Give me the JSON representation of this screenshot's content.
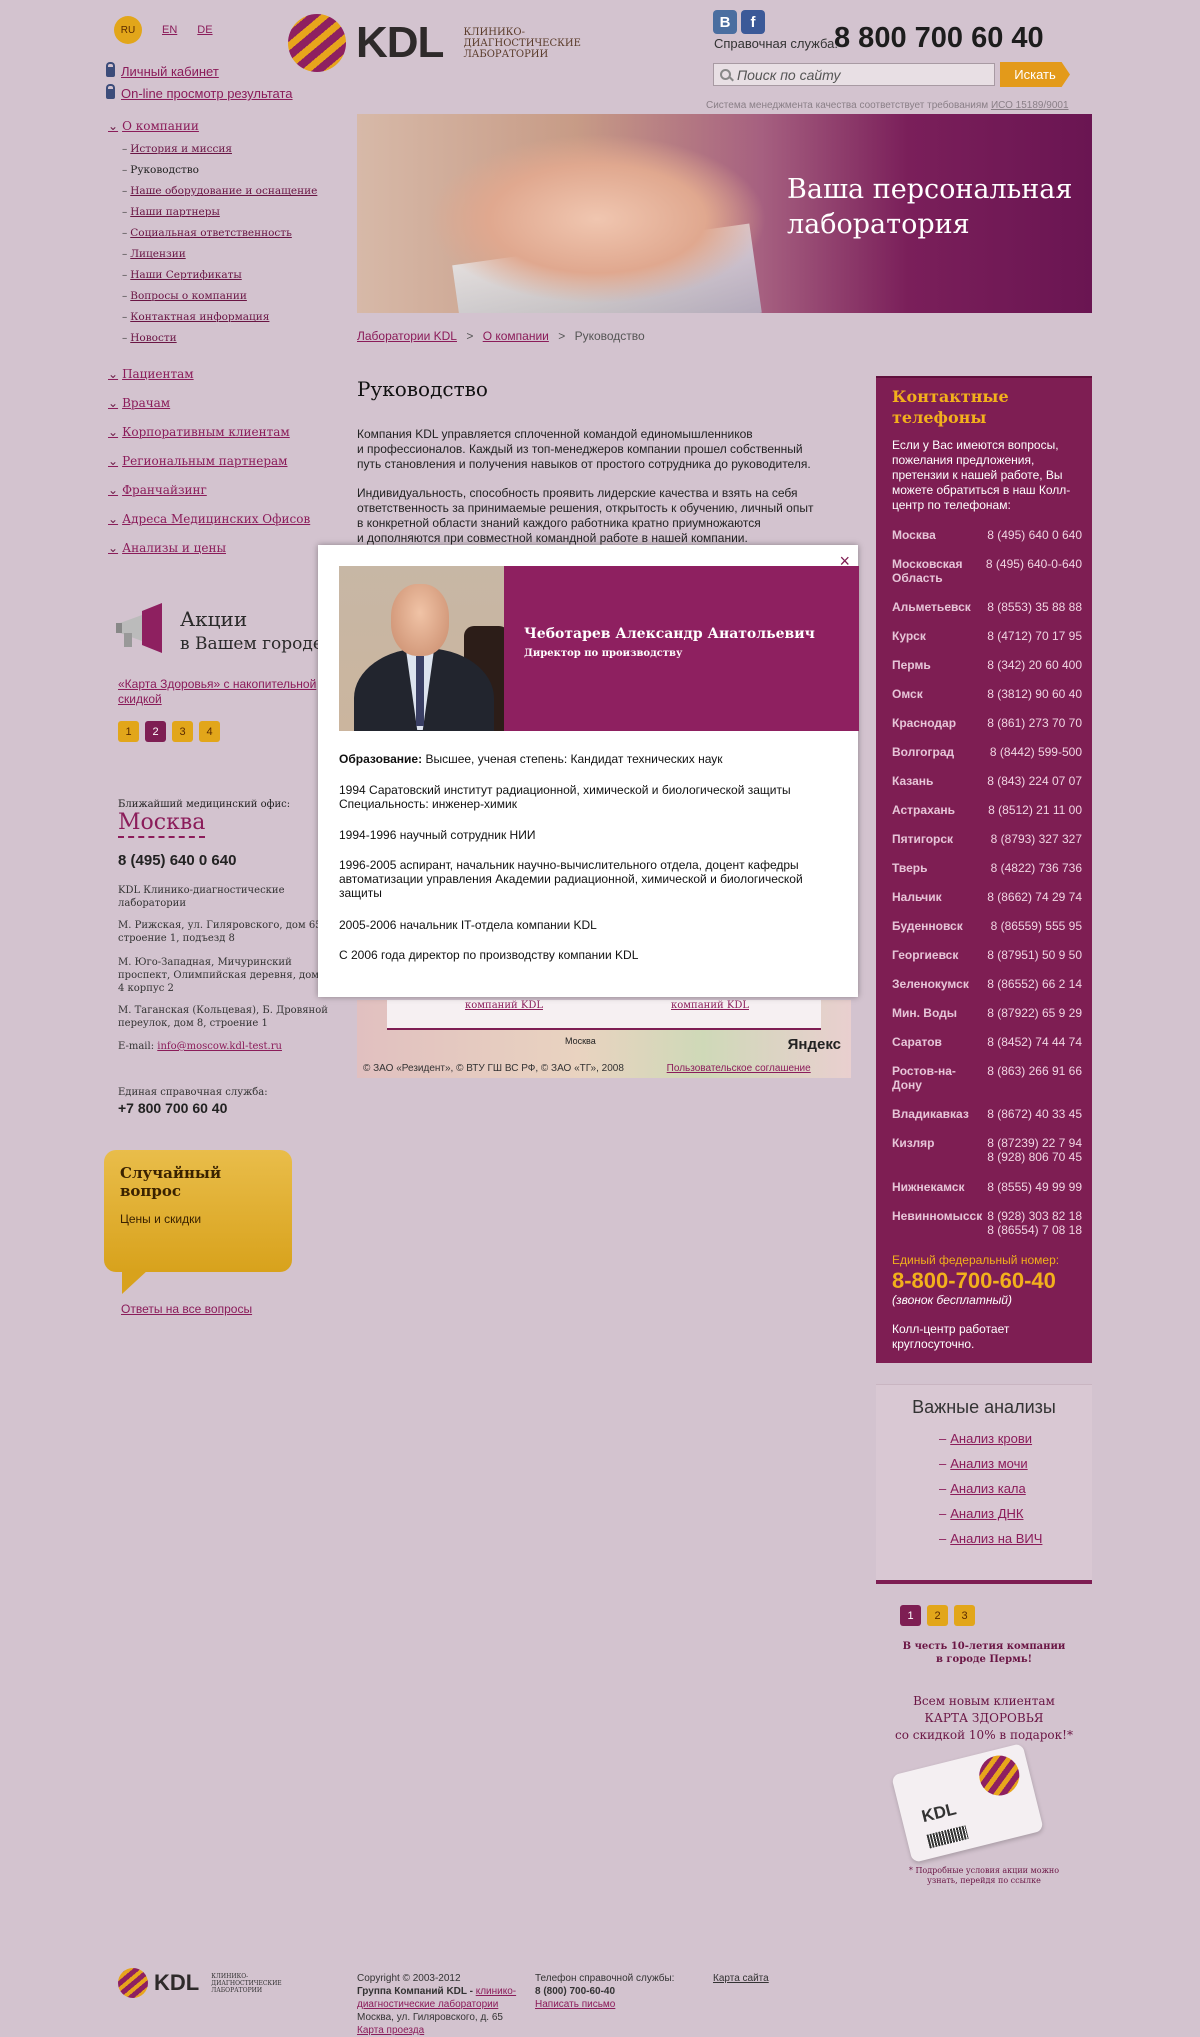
{
  "header": {
    "lang": {
      "current": "RU",
      "others": [
        "EN",
        "DE"
      ]
    },
    "account_links": [
      "Личный кабинет",
      "On-line просмотр результата"
    ],
    "logo": {
      "name": "KDL",
      "subtitle_lines": [
        "КЛИНИКО-",
        "ДИАГНОСТИЧЕСКИЕ",
        "ЛАБОРАТОРИИ"
      ]
    },
    "social": {
      "vk": "В",
      "fb": "f"
    },
    "service_label": "Справочная служба:",
    "service_phone": "8 800 700 60 40",
    "search_placeholder": "Поиск по сайту",
    "search_button": "Искать",
    "iso_text": "Система менеджмента качества соответствует требованиям",
    "iso_link": "ИСО 15189/9001"
  },
  "nav": {
    "about": "О компании",
    "about_sub": [
      "История и миссия",
      "Руководство",
      "Наше оборудование и оснащение",
      "Наши партнеры",
      "Социальная ответственность",
      "Лицензии",
      "Наши Сертификаты",
      "Вопросы о компании",
      "Контактная информация",
      "Новости"
    ],
    "sections": [
      "Пациентам",
      "Врачам",
      "Корпоративным клиентам",
      "Региональным партнерам",
      "Франчайзинг",
      "Адреса Медицинских Офисов",
      "Анализы и цены"
    ]
  },
  "promo": {
    "title": "Акции",
    "subtitle": "в Вашем городе",
    "link": "«Карта Здоровья» с накопительной скидкой",
    "pages": [
      "1",
      "2",
      "3",
      "4"
    ]
  },
  "nearest": {
    "label": "Ближайший медицинский офис:",
    "city": "Москва",
    "phone": "8 (495) 640 0 640",
    "org": "KDL Клинико-диагностические лаборатории",
    "addr1": "М. Рижская, ул. Гиляровского, дом 65, строение 1, подъезд 8",
    "addr2": "М. Юго-Западная, Мичуринский проспект, Олимпийская деревня, дом 4 корпус 2",
    "addr3": "М. Таганская (Кольцевая), Б. Дровяной переулок, дом 8, строение 1",
    "email_label": "E-mail:",
    "email": "info@moscow.kdl-test.ru",
    "unified_label": "Единая справочная служба:",
    "unified_phone": "+7 800 700 60 40"
  },
  "random_q": {
    "title": "Случайный вопрос",
    "text": "Цены и скидки",
    "all": "Ответы на все вопросы"
  },
  "hero": {
    "line1": "Ваша персональная",
    "line2": "лаборатория"
  },
  "breadcrumb": {
    "items": [
      "Лаборатории KDL",
      "О компании"
    ],
    "current": "Руководство",
    "sep": ">"
  },
  "page": {
    "title": "Руководство",
    "p1_l1": "Компания KDL управляется сплоченной командой единомышленников",
    "p1_l2": "и профессионалов. Каждый из топ-менеджеров компании прошел собственный",
    "p1_l3": "путь становления и получения навыков от простого сотрудника до руководителя.",
    "p2_l1": "Индивидуальность, способность проявить лидерские качества и взять на себя",
    "p2_l2": "ответственность за принимаемые решения, открытость к обучению, личный опыт",
    "p2_l3": "в конкретной области знаний каждого работника кратно приумножаются",
    "p2_l4": "и дополняются при совместной командной работе в нашей компании."
  },
  "map": {
    "card_links": [
      "компаний KDL",
      "компаний KDL"
    ],
    "city": "Москва",
    "footer": "© ЗАО «Резидент», © ВТУ ГШ ВС РФ, © ЗАО «ТГ», 2008",
    "agreement": "Пользовательское соглашение",
    "yandex": "Яндекс"
  },
  "contacts": {
    "title_l1": "Контактные",
    "title_l2": "телефоны",
    "intro": "Если у Вас имеются вопросы, пожелания предложения, претензии к нашей работе, Вы можете обратиться в наш Колл-центр по телефонам:",
    "rows": [
      {
        "city": "Москва",
        "phone": "8 (495) 640 0 640"
      },
      {
        "city": "Московская Область",
        "phone": "8 (495) 640-0-640"
      },
      {
        "city": "Альметьевск",
        "phone": "8 (8553) 35 88 88"
      },
      {
        "city": "Курск",
        "phone": "8 (4712) 70 17 95"
      },
      {
        "city": "Пермь",
        "phone": "8 (342) 20 60 400"
      },
      {
        "city": "Омск",
        "phone": "8 (3812) 90 60 40"
      },
      {
        "city": "Краснодар",
        "phone": "8 (861) 273 70 70"
      },
      {
        "city": "Волгоград",
        "phone": "8 (8442) 599-500"
      },
      {
        "city": "Казань",
        "phone": "8 (843) 224 07 07"
      },
      {
        "city": "Астрахань",
        "phone": "8 (8512) 21 11 00"
      },
      {
        "city": "Пятигорск",
        "phone": "8 (8793) 327 327"
      },
      {
        "city": "Тверь",
        "phone": "8 (4822) 736 736"
      },
      {
        "city": "Нальчик",
        "phone": "8 (8662) 74 29 74"
      },
      {
        "city": "Буденновск",
        "phone": "8 (86559) 555 95"
      },
      {
        "city": "Георгиевск",
        "phone": "8 (87951) 50 9 50"
      },
      {
        "city": "Зеленокумск",
        "phone": "8 (86552) 66 2 14"
      },
      {
        "city": "Мин. Воды",
        "phone": "8 (87922) 65 9 29"
      },
      {
        "city": "Саратов",
        "phone": "8 (8452) 74 44 74"
      },
      {
        "city": "Ростов-на-Дону",
        "phone": "8 (863) 266 91 66"
      },
      {
        "city": "Владикавказ",
        "phone": "8 (8672) 40 33 45"
      },
      {
        "city": "Кизляр",
        "phone": "8 (87239) 22 7 94\n8 (928) 806 70 45"
      },
      {
        "city": "Нижнекамск",
        "phone": "8 (8555) 49 99 99"
      },
      {
        "city": "Невинномысск",
        "phone": "8 (928) 303 82 18\n8 (86554) 7 08 18"
      }
    ],
    "fed_label": "Единый федеральный номер:",
    "fed_number": "8-800-700-60-40",
    "fed_note": "(звонок бесплатный)",
    "callcenter": "Колл-центр работает круглосуточно."
  },
  "important": {
    "title": "Важные анализы",
    "items": [
      "Анализ крови",
      "Анализ мочи",
      "Анализ кала",
      "Анализ ДНК",
      "Анализ на ВИЧ"
    ]
  },
  "right_promo": {
    "pages": [
      "1",
      "2",
      "3"
    ],
    "perm_l1": "В честь 10-летия компании",
    "perm_l2": "в городе Пермь!",
    "new_l1": "Всем новым клиентам",
    "new_l2": "КАРТА ЗДОРОВЬЯ",
    "new_l3": "со скидкой 10% в подарок!*",
    "card_logo": "KDL",
    "note_l1": "* Подробные условия акции можно",
    "note_l2": "узнать, перейдя по ссылке"
  },
  "footer": {
    "logo": "KDL",
    "logo_sub": [
      "КЛИНИКО-",
      "ДИАГНОСТИЧЕСКИЕ",
      "ЛАБОРАТОРИИ"
    ],
    "copyright": "Copyright © 2003-2012",
    "group": "Группа Компаний KDL -",
    "group_link": "клинико-диагностические лаборатории",
    "address": "Москва, ул. Гиляровского, д. 65",
    "route": "Карта проезда",
    "phone_label": "Телефон справочной службы:",
    "phone": "8 (800) 700-60-40",
    "write": "Написать письмо",
    "sitemap": "Карта сайта"
  },
  "modal": {
    "close": "×",
    "name": "Чеботарев Александр Анатольевич",
    "position": "Директор по производству",
    "edu_label": "Образование:",
    "edu": "Высшее, ученая степень: Кандидат технических наук",
    "e1_l1": "1994 Саратовский институт радиационной, химической и биологической защиты",
    "e1_l2": "Специальность: инженер-химик",
    "e2": "1994-1996 научный сотрудник НИИ",
    "e3_l1": "1996-2005 аспирант, начальник научно-вычислительного отдела, доцент кафедры",
    "e3_l2": "автоматизации управления  Академии радиационной, химической и биологической",
    "e3_l3": "защиты",
    "e4": "2005-2006 начальник IT-отдела компании KDL",
    "e5": "С 2006 года директор по производству компании KDL"
  },
  "colors": {
    "brand": "#7e1e53",
    "accent": "#e2a61a",
    "bg": "#d3c3cf"
  }
}
